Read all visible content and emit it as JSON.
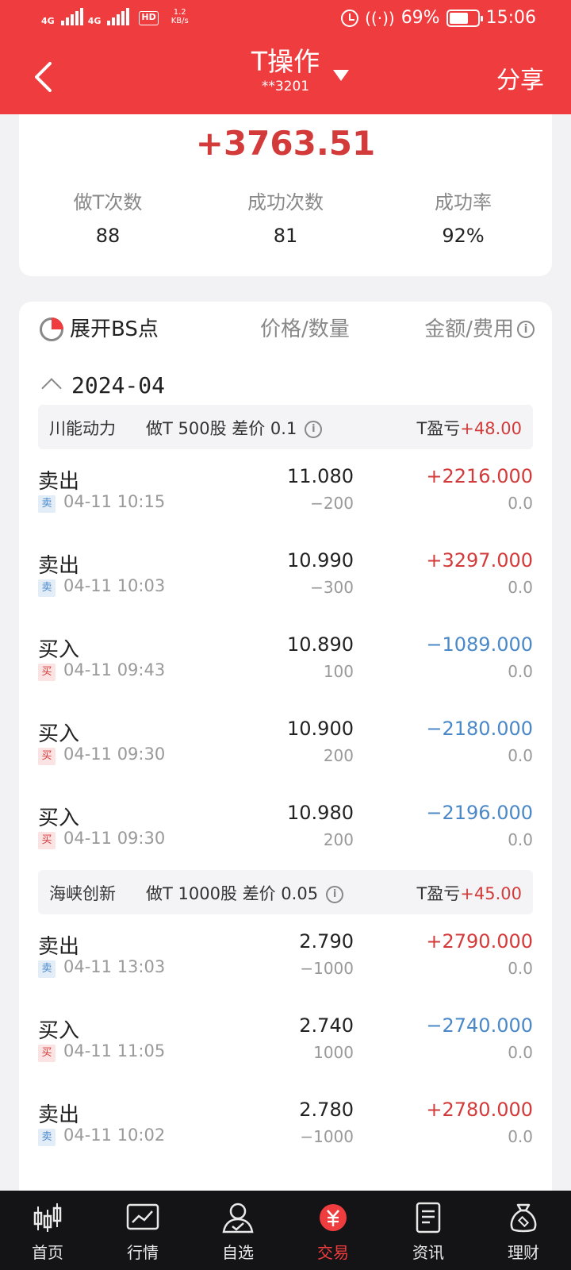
{
  "status": {
    "network1": "4G",
    "network2": "4G",
    "hd": "HD",
    "speed_value": "1.2",
    "speed_unit": "KB/s",
    "battery": "69%",
    "battery_level": 0.69,
    "time": "15:06"
  },
  "header": {
    "title": "T操作",
    "account": "**3201",
    "share_label": "分享"
  },
  "summary": {
    "total": "+3763.51",
    "stats": [
      {
        "label": "做T次数",
        "value": "88"
      },
      {
        "label": "成功次数",
        "value": "81"
      },
      {
        "label": "成功率",
        "value": "92%"
      }
    ]
  },
  "list_header": {
    "expand_label": "展开BS点",
    "price_qty_label": "价格/数量",
    "amount_fee_label": "金额/费用"
  },
  "month": "2024-04",
  "groups": [
    {
      "name": "川能动力",
      "info": "做T 500股 差价 0.1",
      "pl_label": "T盈亏",
      "pl_value": "+48.00",
      "trades": [
        {
          "action": "卖出",
          "badge": "卖",
          "type": "sell",
          "time": "04-11 10:15",
          "price": "11.080",
          "qty": "−200",
          "amount": "+2216.000",
          "fee": "0.0"
        },
        {
          "action": "卖出",
          "badge": "卖",
          "type": "sell",
          "time": "04-11 10:03",
          "price": "10.990",
          "qty": "−300",
          "amount": "+3297.000",
          "fee": "0.0"
        },
        {
          "action": "买入",
          "badge": "买",
          "type": "buy",
          "time": "04-11 09:43",
          "price": "10.890",
          "qty": "100",
          "amount": "−1089.000",
          "fee": "0.0"
        },
        {
          "action": "买入",
          "badge": "买",
          "type": "buy",
          "time": "04-11 09:30",
          "price": "10.900",
          "qty": "200",
          "amount": "−2180.000",
          "fee": "0.0"
        },
        {
          "action": "买入",
          "badge": "买",
          "type": "buy",
          "time": "04-11 09:30",
          "price": "10.980",
          "qty": "200",
          "amount": "−2196.000",
          "fee": "0.0"
        }
      ]
    },
    {
      "name": "海峡创新",
      "info": "做T 1000股 差价 0.05",
      "pl_label": "T盈亏",
      "pl_value": "+45.00",
      "trades": [
        {
          "action": "卖出",
          "badge": "卖",
          "type": "sell",
          "time": "04-11 13:03",
          "price": "2.790",
          "qty": "−1000",
          "amount": "+2790.000",
          "fee": "0.0"
        },
        {
          "action": "买入",
          "badge": "买",
          "type": "buy",
          "time": "04-11 11:05",
          "price": "2.740",
          "qty": "1000",
          "amount": "−2740.000",
          "fee": "0.0"
        },
        {
          "action": "卖出",
          "badge": "卖",
          "type": "sell",
          "time": "04-11 10:02",
          "price": "2.780",
          "qty": "−1000",
          "amount": "+2780.000",
          "fee": "0.0"
        }
      ]
    }
  ],
  "tabs": [
    {
      "label": "首页",
      "icon": "candlestick-icon"
    },
    {
      "label": "行情",
      "icon": "market-chart-icon"
    },
    {
      "label": "自选",
      "icon": "user-favorite-icon"
    },
    {
      "label": "交易",
      "icon": "yuan-icon",
      "active": true
    },
    {
      "label": "资讯",
      "icon": "news-document-icon"
    },
    {
      "label": "理财",
      "icon": "money-bag-icon"
    }
  ],
  "colors": {
    "brand": "#ef3d3f",
    "profit": "#d33a3a",
    "loss": "#4a88c8"
  }
}
